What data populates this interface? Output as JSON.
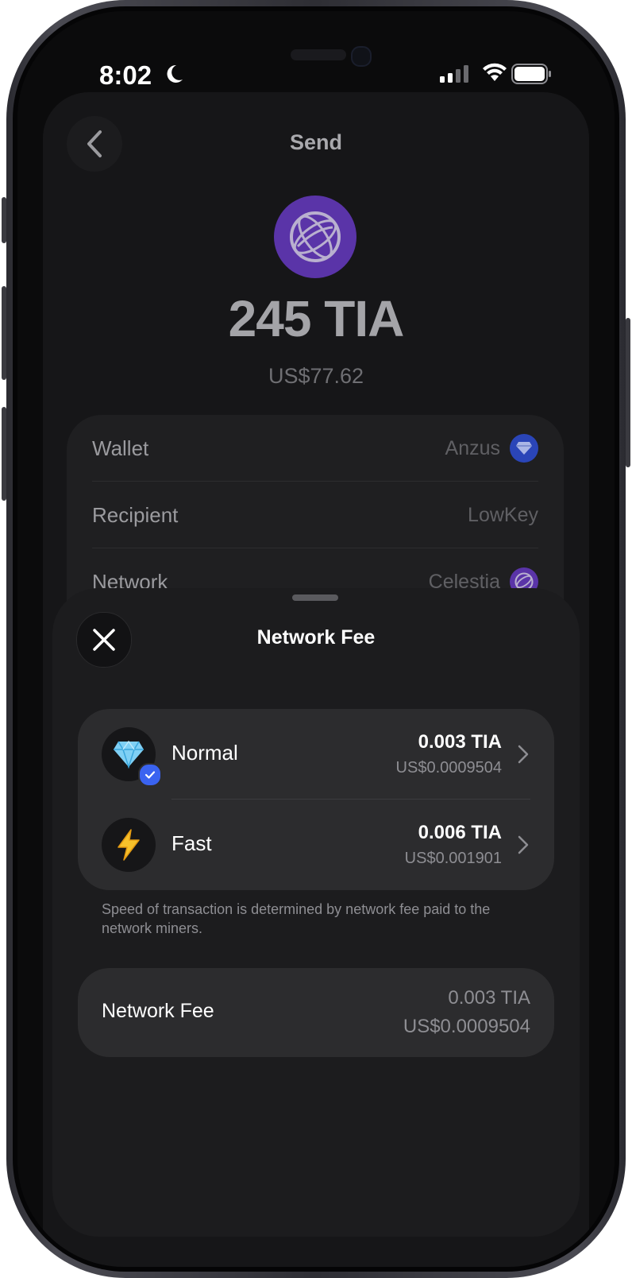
{
  "status_bar": {
    "time": "8:02"
  },
  "send_page": {
    "title": "Send",
    "amount": "245 TIA",
    "amount_fiat": "US$77.62",
    "rows": [
      {
        "label": "Wallet",
        "value": "Anzus",
        "icon": "gem-icon"
      },
      {
        "label": "Recipient",
        "value": "LowKey"
      },
      {
        "label": "Network",
        "value": "Celestia",
        "icon": "celestia-icon"
      }
    ]
  },
  "sheet": {
    "title": "Network Fee",
    "options": [
      {
        "name": "Normal",
        "icon": "gem-icon",
        "amount": "0.003 TIA",
        "fiat": "US$0.0009504",
        "selected": true
      },
      {
        "name": "Fast",
        "icon": "lightning-icon",
        "amount": "0.006 TIA",
        "fiat": "US$0.001901",
        "selected": false
      }
    ],
    "hint": "Speed of transaction is determined by network fee paid to the network miners.",
    "summary": {
      "label": "Network Fee",
      "amount": "0.003 TIA",
      "fiat": "US$0.0009504"
    }
  },
  "colors": {
    "token_purple": "#5a34a8",
    "check_blue": "#3a63f0",
    "sheet_bg": "#1c1c1e",
    "card_bg": "#2c2c2e"
  }
}
